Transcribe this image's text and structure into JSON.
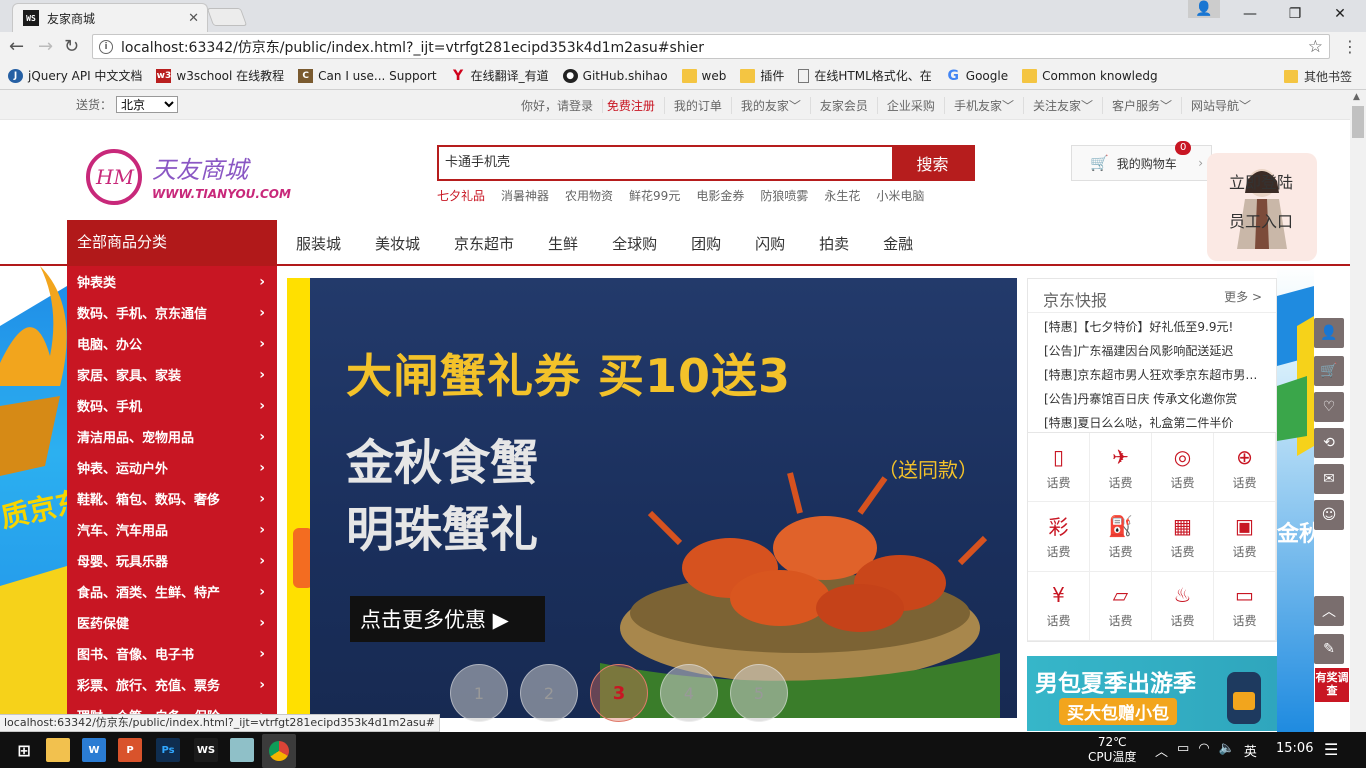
{
  "browser": {
    "tab_title": "友家商城",
    "tab_favicon": "WS",
    "url": "localhost:63342/仿京东/public/index.html?_ijt=vtrfgt281ecipd353k4d1m2asu#shier",
    "bookmarks": [
      {
        "label": "jQuery API 中文文档",
        "icon": "jquery-icon"
      },
      {
        "label": "w3school 在线教程",
        "icon": "w3-icon"
      },
      {
        "label": "Can I use... Support",
        "icon": "caniuse-icon"
      },
      {
        "label": "在线翻译_有道",
        "icon": "youdao-icon"
      },
      {
        "label": "GitHub.shihao",
        "icon": "github-icon"
      },
      {
        "label": "web",
        "icon": "folder-icon"
      },
      {
        "label": "插件",
        "icon": "folder-icon"
      },
      {
        "label": "在线HTML格式化、在",
        "icon": "page-icon"
      },
      {
        "label": "Google",
        "icon": "google-icon"
      },
      {
        "label": "Common knowledg",
        "icon": "folder-icon"
      }
    ],
    "other_bookmarks": "其他书签",
    "status_url": "localhost:63342/仿京东/public/index.html?_ijt=vtrfgt281ecipd353k4d1m2asu#"
  },
  "site": {
    "topbar": {
      "ship_label": "送货：",
      "ship_city": "北京",
      "login_text": "你好，请登录",
      "register": "免费注册",
      "links": [
        "我的订单",
        "我的友家﹀",
        "友家会员",
        "企业采购",
        "手机友家﹀",
        "关注友家﹀",
        "客户服务﹀",
        "网站导航﹀"
      ]
    },
    "logo": {
      "cn": "天友商城",
      "en": "WWW.TIANYOU.COM",
      "mark": "HM"
    },
    "search": {
      "value": "卡通手机壳",
      "button": "搜索",
      "hotwords": [
        "七夕礼品",
        "消暑神器",
        "农用物资",
        "鲜花99元",
        "电影金券",
        "防狼喷雾",
        "永生花",
        "小米电脑"
      ]
    },
    "cart": {
      "label": "我的购物车",
      "count": "0"
    },
    "mascot": {
      "line1": "立即登陆",
      "line2": "员工入口"
    },
    "nav": {
      "all_categories": "全部商品分类",
      "items": [
        "服装城",
        "美妆城",
        "京东超市",
        "生鲜",
        "全球购",
        "团购",
        "闪购",
        "拍卖",
        "金融"
      ]
    },
    "categories": [
      "钟表类",
      "数码、手机、京东通信",
      "电脑、办公",
      "家居、家具、家装",
      "数码、手机",
      "清洁用品、宠物用品",
      "钟表、运动户外",
      "鞋靴、箱包、数码、奢侈",
      "汽车、汽车用品",
      "母婴、玩具乐器",
      "食品、酒类、生鲜、特产",
      "医药保健",
      "图书、音像、电子书",
      "彩票、旅行、充值、票务",
      "理财、众筹、白条、保险"
    ],
    "banner": {
      "headline": "大闸蟹礼券 买10送3",
      "line2": "金秋食蟹",
      "line3": "明珠蟹礼",
      "gift": "（送同款）",
      "cta": "点击更多优惠 ▶",
      "dots": [
        "1",
        "2",
        "3",
        "4",
        "5"
      ],
      "active_dot": 3
    },
    "news": {
      "title": "京东快报",
      "more": "更多 >",
      "items": [
        {
          "tag": "[特惠]",
          "text": "【七夕特价】好礼低至9.9元!"
        },
        {
          "tag": "[公告]",
          "text": "广东福建因台风影响配送延迟"
        },
        {
          "tag": "[特惠]",
          "text": "京东超市男人狂欢季京东超市男人狂欢季"
        },
        {
          "tag": "[公告]",
          "text": "丹寨馆百日庆 传承文化邀你赏"
        },
        {
          "tag": "[特惠]",
          "text": "夏日么么哒，礼盒第二件半价"
        }
      ]
    },
    "services": [
      {
        "icon": "phone-icon",
        "label": "话费"
      },
      {
        "icon": "plane-icon",
        "label": "话费"
      },
      {
        "icon": "movie-icon",
        "label": "话费"
      },
      {
        "icon": "gamepad-icon",
        "label": "话费"
      },
      {
        "icon": "lottery-icon",
        "label": "话费",
        "glyph": "彩"
      },
      {
        "icon": "fuel-icon",
        "label": "话费"
      },
      {
        "icon": "hotel-icon",
        "label": "话费"
      },
      {
        "icon": "train-icon",
        "label": "话费"
      },
      {
        "icon": "finance-icon",
        "label": "话费"
      },
      {
        "icon": "bag-icon",
        "label": "话费"
      },
      {
        "icon": "payment-icon",
        "label": "话费"
      },
      {
        "icon": "card-icon",
        "label": "话费"
      }
    ],
    "promo": {
      "line1": "男包夏季出游季",
      "line2": "买大包赠小包"
    },
    "left_deco_text": "质京东",
    "right_deco_text": "金秋狂欢",
    "survey": "有奖调查"
  },
  "taskbar": {
    "temp": "72℃",
    "cpu_label": "CPU温度",
    "ime": "英",
    "time": "15:06"
  },
  "colors": {
    "brand_red": "#c81623",
    "nav_red": "#b1191a",
    "banner_bg": "#1a2f5c",
    "banner_gold": "#f3c22a"
  }
}
